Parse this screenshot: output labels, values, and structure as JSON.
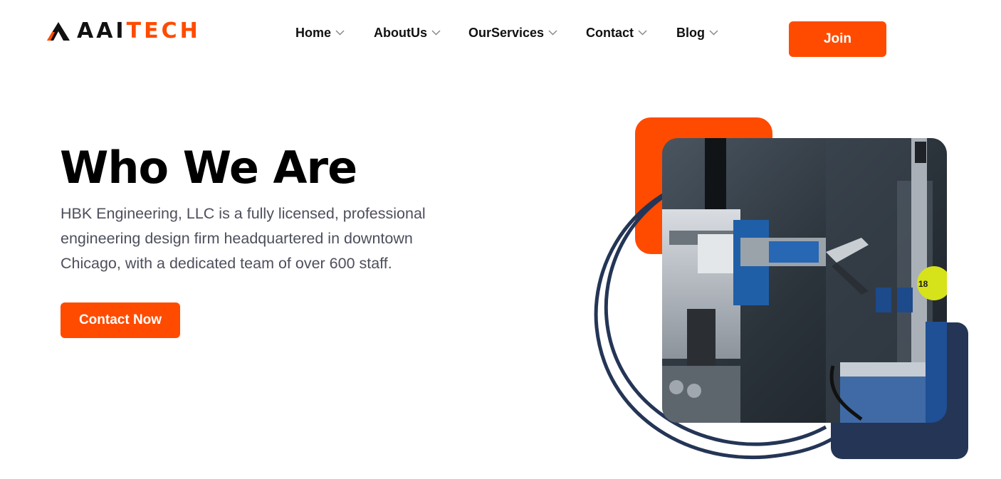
{
  "logo": {
    "text_dark": "AAI",
    "text_accent": "TECH"
  },
  "nav": {
    "items": [
      {
        "label": "Home"
      },
      {
        "label": "AboutUs"
      },
      {
        "label": "OurServices"
      },
      {
        "label": "Contact"
      },
      {
        "label": "Blog"
      }
    ],
    "join_label": "Join"
  },
  "hero": {
    "title": "Who We Are",
    "description": "HBK Engineering, LLC is a fully licensed, professional engineering design firm headquartered in downtown Chicago, with a dedicated team of over 600 staff.",
    "cta_label": "Contact Now"
  },
  "icons": {
    "logo": "triangle-logo-icon",
    "chevron": "chevron-down-icon"
  },
  "colors": {
    "accent": "#ff4b00",
    "navy": "#243556",
    "text": "#111111",
    "body_text": "#4d4f5c"
  },
  "image": {
    "label": "18"
  }
}
